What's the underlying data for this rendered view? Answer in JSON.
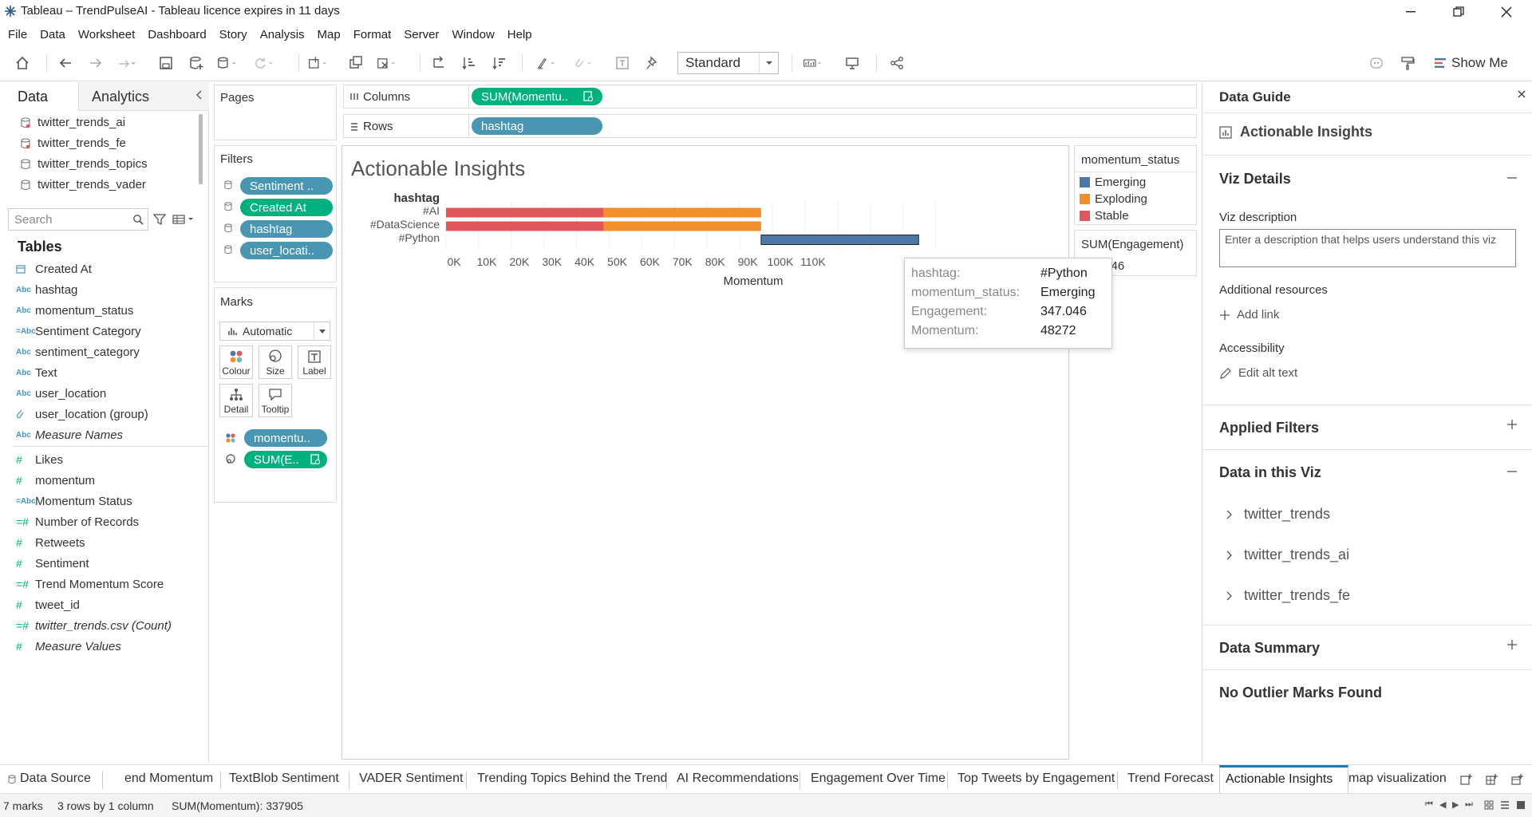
{
  "window": {
    "title": "Tableau – TrendPulseAI - Tableau licence expires in 11 days"
  },
  "menu": [
    "File",
    "Data",
    "Worksheet",
    "Dashboard",
    "Story",
    "Analysis",
    "Map",
    "Format",
    "Server",
    "Window",
    "Help"
  ],
  "toolbar": {
    "view_size": "Standard",
    "show_me": "Show Me"
  },
  "left_pane": {
    "tab_data": "Data",
    "tab_analytics": "Analytics",
    "data_sources": [
      "twitter_trends_ai",
      "twitter_trends_fe",
      "twitter_trends_topics",
      "twitter_trends_vader"
    ],
    "search_placeholder": "Search",
    "tables_heading": "Tables",
    "dimensions": [
      {
        "type": "date",
        "name": "Created At"
      },
      {
        "type": "Abc",
        "name": "hashtag"
      },
      {
        "type": "Abc",
        "name": "momentum_status"
      },
      {
        "type": "=Abc",
        "name": "Sentiment Category"
      },
      {
        "type": "Abc",
        "name": "sentiment_category"
      },
      {
        "type": "Abc",
        "name": "Text"
      },
      {
        "type": "Abc",
        "name": "user_location"
      },
      {
        "type": "group",
        "name": "user_location (group)"
      },
      {
        "type": "Abc",
        "name": "Measure Names"
      }
    ],
    "measures": [
      {
        "type": "#",
        "name": "Likes"
      },
      {
        "type": "#",
        "name": "momentum"
      },
      {
        "type": "=Abc",
        "name": "Momentum Status"
      },
      {
        "type": "=#",
        "name": "Number of Records"
      },
      {
        "type": "#",
        "name": "Retweets"
      },
      {
        "type": "#",
        "name": "Sentiment"
      },
      {
        "type": "=#",
        "name": "Trend Momentum Score"
      },
      {
        "type": "#",
        "name": "tweet_id"
      },
      {
        "type": "=#",
        "name": "twitter_trends.csv (Count)"
      },
      {
        "type": "#",
        "name": "Measure Values"
      }
    ]
  },
  "pages": {
    "title": "Pages"
  },
  "filters": {
    "title": "Filters",
    "pills": [
      "Sentiment ..",
      "Created At",
      "hashtag",
      "user_locati.."
    ]
  },
  "marks": {
    "title": "Marks",
    "mark_type": "Automatic",
    "buttons": [
      "Colour",
      "Size",
      "Label",
      "Detail",
      "Tooltip"
    ],
    "pills": [
      "momentu..",
      "SUM(E.."
    ]
  },
  "shelves": {
    "columns_label": "Columns",
    "columns_pill": "SUM(Momentu..",
    "rows_label": "Rows",
    "rows_pill": "hashtag"
  },
  "viz": {
    "title": "Actionable Insights",
    "row_header": "hashtag"
  },
  "chart_data": {
    "type": "bar",
    "stacked": true,
    "orientation": "horizontal",
    "categories": [
      "#AI",
      "#DataScience",
      "#Python"
    ],
    "series": [
      {
        "name": "Stable",
        "color": "#e15759",
        "values": [
          48272,
          48272,
          0
        ]
      },
      {
        "name": "Exploding",
        "color": "#f28e2b",
        "values": [
          48272,
          48272,
          0
        ]
      },
      {
        "name": "Emerging",
        "color": "#4e79a7",
        "values": [
          0,
          0,
          48272
        ]
      }
    ],
    "offsets": [
      0,
      0,
      96544
    ],
    "xlabel": "Momentum",
    "xticks": [
      "0K",
      "10K",
      "20K",
      "30K",
      "40K",
      "50K",
      "60K",
      "70K",
      "80K",
      "90K",
      "100K",
      "110K"
    ],
    "xlim": [
      0,
      150000
    ],
    "ylabel": "hashtag",
    "grid": true
  },
  "legend": {
    "color_title": "momentum_status",
    "items": [
      {
        "label": "Emerging",
        "color": "#4e79a7"
      },
      {
        "label": "Exploding",
        "color": "#f28e2b"
      },
      {
        "label": "Stable",
        "color": "#e15759"
      }
    ],
    "size_title": "SUM(Engagement)",
    "size_value": "347.046"
  },
  "tooltip": {
    "rows": [
      {
        "key": "hashtag:",
        "value": "#Python"
      },
      {
        "key": "momentum_status:",
        "value": "Emerging"
      },
      {
        "key": "Engagement:",
        "value": "347.046"
      },
      {
        "key": "Momentum:",
        "value": "48272"
      }
    ]
  },
  "data_guide": {
    "title": "Data Guide",
    "viz_name": "Actionable Insights",
    "viz_details": "Viz Details",
    "viz_description_label": "Viz description",
    "viz_description_placeholder": "Enter a description that helps users understand this viz",
    "additional_resources": "Additional resources",
    "add_link": "Add link",
    "accessibility": "Accessibility",
    "edit_alt_text": "Edit alt text",
    "applied_filters": "Applied Filters",
    "data_in_viz": "Data in this Viz",
    "data_sources": [
      "twitter_trends",
      "twitter_trends_ai",
      "twitter_trends_fe"
    ],
    "data_summary": "Data Summary",
    "no_outliers": "No Outlier Marks Found"
  },
  "sheet_tabs": {
    "data_source": "Data Source",
    "tabs": [
      "end Momentum",
      "TextBlob Sentiment",
      "VADER Sentiment",
      "Trending Topics Behind the Trend",
      "AI Recommendations",
      "Engagement Over Time",
      "Top Tweets by Engagement",
      "Trend Forecast",
      "Actionable Insights",
      "map visualization"
    ],
    "active": "Actionable Insights"
  },
  "status": {
    "marks": "7 marks",
    "rows_cols": "3 rows by 1 column",
    "sum": "SUM(Momentum): 337905"
  }
}
